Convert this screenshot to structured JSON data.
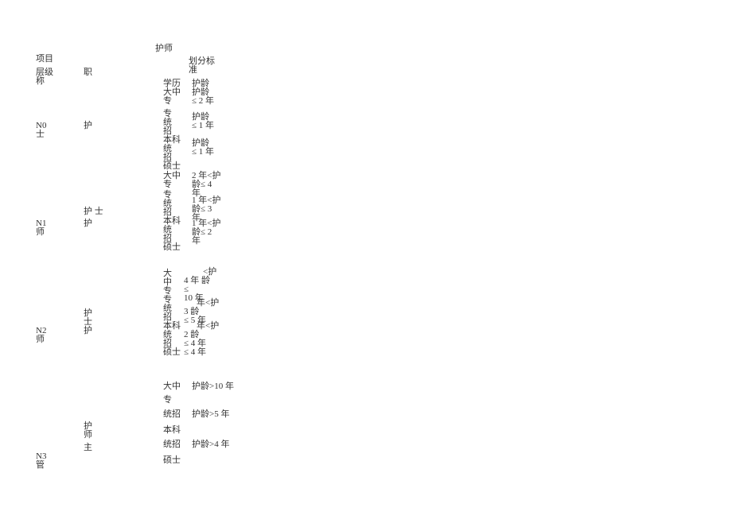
{
  "header": {
    "title": "护师",
    "subtitle": "划分标准"
  },
  "columns": {
    "project": "项目",
    "level_name_l1": "层级",
    "level_name_l2": "称",
    "title_col": "职",
    "edu_col": "学历",
    "age_col": "护龄"
  },
  "levels": {
    "n0": {
      "id_l1": "N0",
      "id_l2": "士",
      "title": "护",
      "rows": [
        {
          "edu_l1": "大中",
          "edu_l2": "专",
          "age": "护龄 ≤ 2  年"
        },
        {
          "edu_l1": "专",
          "edu_l2": "统招",
          "age": "护龄 ≤ 1  年"
        },
        {
          "edu_l1": "本科",
          "edu_l2": "统招",
          "age": "护龄 ≤ 1  年"
        },
        {
          "edu_l1": "硕士",
          "edu_l2": "",
          "age": ""
        }
      ]
    },
    "n1": {
      "id_l1": "N1",
      "id_l2": "师",
      "titles": {
        "t1": "护 士",
        "t2": "护"
      },
      "rows": [
        {
          "edu": "大中专",
          "age": "2 年<护龄≤ 4 年"
        },
        {
          "edu": "专 统招",
          "age": "1 年<护龄≤ 3 年"
        },
        {
          "edu": "本科 统招",
          "age": "1 年<护龄≤ 2 年"
        },
        {
          "edu": "硕士",
          "age": ""
        }
      ]
    },
    "n2": {
      "id_l1": "N2",
      "id_l2": "师",
      "titles": {
        "t1": "护士",
        "t2": "护"
      },
      "rows": [
        {
          "edu": "大中专",
          "age": "4 年 <护龄 ≤ 10  年"
        },
        {
          "edu": "专 统招",
          "age": "3  年<护龄 ≤ 5 年"
        },
        {
          "edu": "本科 统招",
          "age": "2  年<护龄 ≤ 4 年"
        },
        {
          "edu": "硕士",
          "age": "≤ 4 年"
        }
      ]
    },
    "n3": {
      "id_l1": "N3",
      "id_l2": "管",
      "titles": {
        "t1": "护师",
        "t2": "主"
      },
      "rows": [
        {
          "edu": "大中专",
          "age": "护龄>10 年"
        },
        {
          "edu": "统招",
          "age": "护龄>5 年"
        },
        {
          "edu": "本科",
          "age": ""
        },
        {
          "edu": "统招",
          "age": "护龄>4 年"
        },
        {
          "edu": "硕士",
          "age": ""
        }
      ]
    }
  }
}
